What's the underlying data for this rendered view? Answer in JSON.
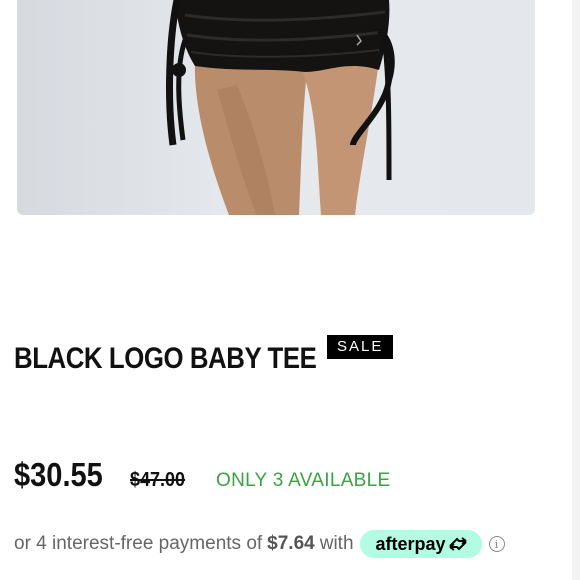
{
  "product": {
    "image_alt": "Model wearing black velvet ruched mini skirt",
    "title": "BLACK LOGO BABY TEE",
    "badge": "SALE",
    "price": "$30.55",
    "original_price": "$47.00",
    "availability": "ONLY 3 AVAILABLE"
  },
  "installments": {
    "prefix": "or 4 interest-free payments of",
    "amount": "$7.64",
    "suffix": "with",
    "provider": "afterpay",
    "info_icon": "info-icon"
  },
  "colors": {
    "sale_badge": "#000000",
    "availability": "#3aa341",
    "afterpay_bg": "#b2fce4"
  }
}
